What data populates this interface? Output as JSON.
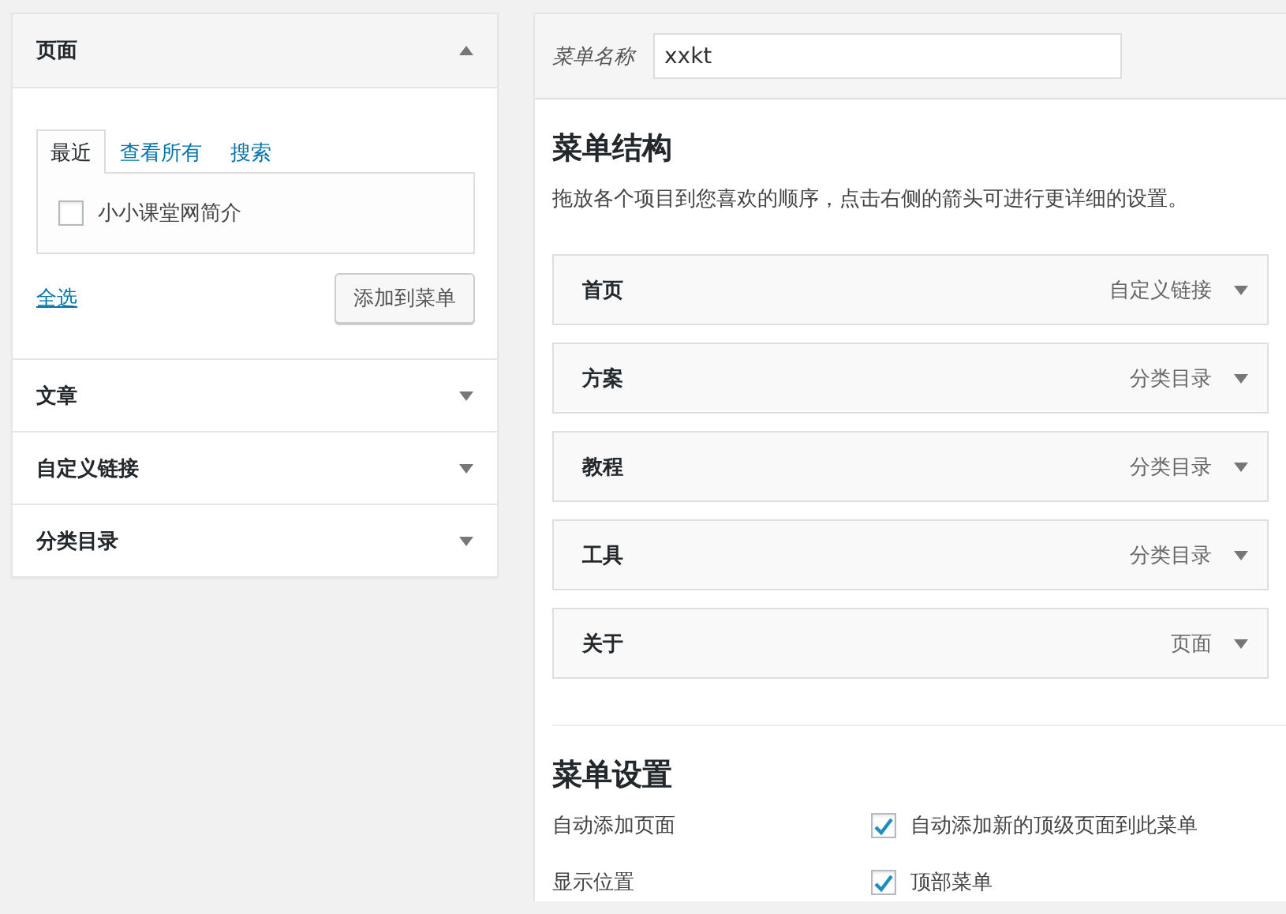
{
  "sections": [
    {
      "title": "页面",
      "expanded": true
    },
    {
      "title": "文章",
      "expanded": false
    },
    {
      "title": "自定义链接",
      "expanded": false
    },
    {
      "title": "分类目录",
      "expanded": false
    }
  ],
  "pages_box": {
    "tabs": [
      {
        "label": "最近",
        "selected": true
      },
      {
        "label": "查看所有",
        "selected": false
      },
      {
        "label": "搜索",
        "selected": false
      }
    ],
    "items": [
      {
        "label": "小小课堂网简介",
        "checked": false
      }
    ],
    "select_all": "全选",
    "add_button": "添加到菜单"
  },
  "menu_name": {
    "label": "菜单名称",
    "value": "xxkt"
  },
  "structure": {
    "title": "菜单结构",
    "description": "拖放各个项目到您喜欢的顺序，点击右侧的箭头可进行更详细的设置。",
    "items": [
      {
        "title": "首页",
        "type": "自定义链接"
      },
      {
        "title": "方案",
        "type": "分类目录"
      },
      {
        "title": "教程",
        "type": "分类目录"
      },
      {
        "title": "工具",
        "type": "分类目录"
      },
      {
        "title": "关于",
        "type": "页面"
      }
    ]
  },
  "settings": {
    "title": "菜单设置",
    "rows": [
      {
        "label": "自动添加页面",
        "option": "自动添加新的顶级页面到此菜单",
        "checked": true
      },
      {
        "label": "显示位置",
        "option": "顶部菜单",
        "checked": true
      }
    ]
  }
}
